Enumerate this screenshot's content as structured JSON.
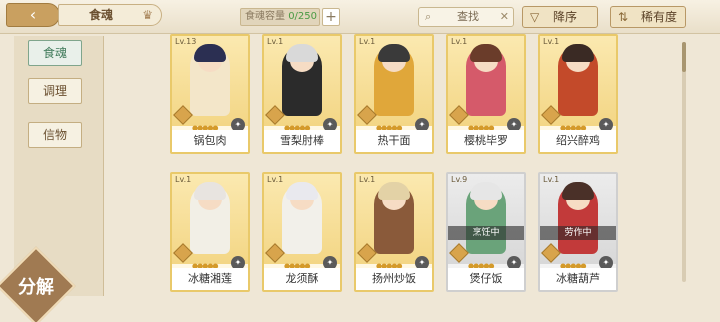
{
  "header": {
    "back_icon": "‹",
    "title": "食魂",
    "title_icon": "crown-icon",
    "capacity_label": "食魂容量",
    "capacity_count": "0/250",
    "capacity_plus": "+",
    "search_placeholder": "查找",
    "sort_order_label": "降序",
    "sort_by_label": "稀有度"
  },
  "sidebar": {
    "tabs": [
      {
        "label": "食魂",
        "active": true
      },
      {
        "label": "调理",
        "active": false
      },
      {
        "label": "信物",
        "active": false
      }
    ],
    "decompose_label": "分解"
  },
  "cards": [
    {
      "level": "Lv.13",
      "name": "锅包肉",
      "status": "",
      "hair": "#2b2f52",
      "outfit": "#f3e6c9",
      "grey": false
    },
    {
      "level": "Lv.1",
      "name": "雪梨肘棒",
      "status": "",
      "hair": "#d9d9d9",
      "outfit": "#2b2b2b",
      "grey": false
    },
    {
      "level": "Lv.1",
      "name": "热干面",
      "status": "",
      "hair": "#3a3a3a",
      "outfit": "#e0a73a",
      "grey": false
    },
    {
      "level": "Lv.1",
      "name": "樱桃毕罗",
      "status": "",
      "hair": "#6a3c2a",
      "outfit": "#d55a6a",
      "grey": false
    },
    {
      "level": "Lv.1",
      "name": "绍兴醉鸡",
      "status": "",
      "hair": "#3a2a24",
      "outfit": "#c34a2a",
      "grey": false
    },
    {
      "level": "Lv.1",
      "name": "冰糖湘莲",
      "status": "",
      "hair": "#e8e4e0",
      "outfit": "#f2efe6",
      "grey": false
    },
    {
      "level": "Lv.1",
      "name": "龙须酥",
      "status": "",
      "hair": "#e9e9ee",
      "outfit": "#f2f0ea",
      "grey": false
    },
    {
      "level": "Lv.1",
      "name": "扬州炒饭",
      "status": "",
      "hair": "#e3d2a6",
      "outfit": "#8a5a3a",
      "grey": false
    },
    {
      "level": "Lv.9",
      "name": "煲仔饭",
      "status": "烹饪中",
      "hair": "#e6e6e6",
      "outfit": "#6aa37a",
      "grey": true
    },
    {
      "level": "Lv.1",
      "name": "冰糖葫芦",
      "status": "劳作中",
      "hair": "#4a3028",
      "outfit": "#c23a3a",
      "grey": true
    }
  ]
}
